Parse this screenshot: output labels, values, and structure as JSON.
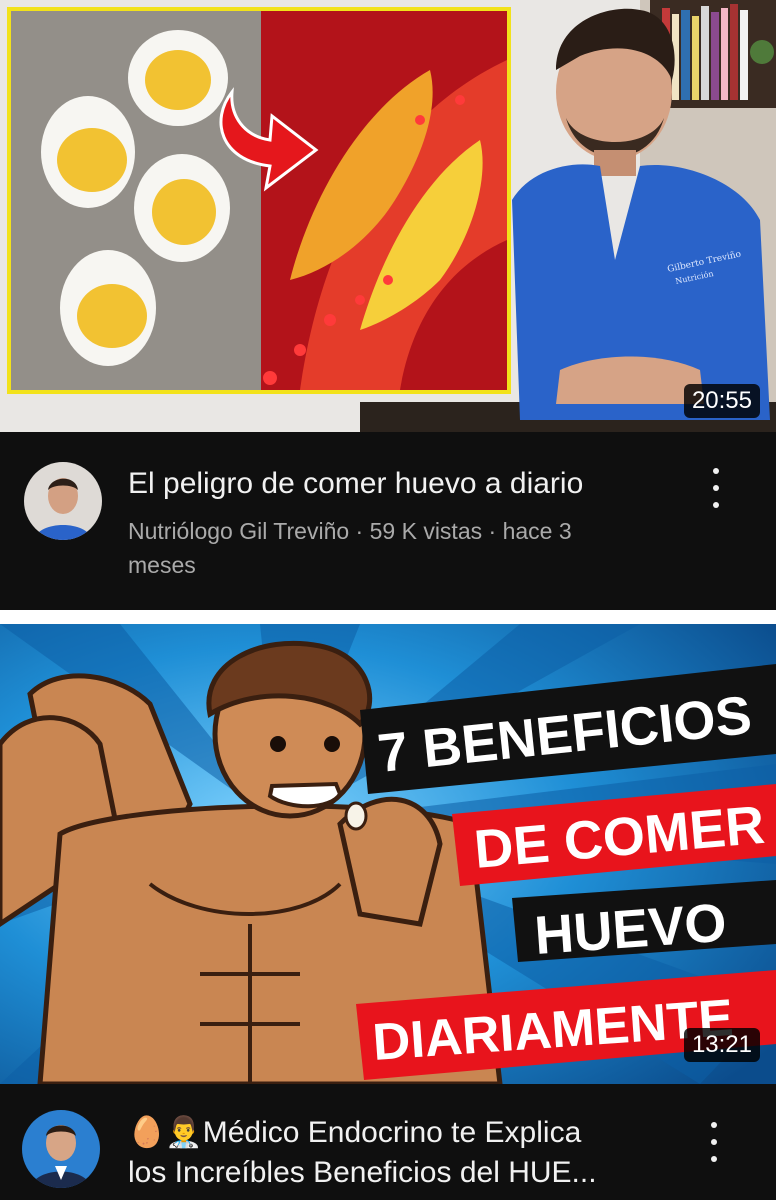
{
  "videos": [
    {
      "duration": "20:55",
      "title": "El peligro de comer huevo a diario",
      "channel": "Nutriólogo Gil Treviño",
      "views": "59 K vistas",
      "age": "hace 3",
      "age_wrap": "meses",
      "dot": "·",
      "shirt_text": "Gilberto Treviño",
      "shirt_sub": "Nutrición"
    },
    {
      "duration": "13:21",
      "thumb_lines": [
        "7 BENEFICIOS",
        "DE COMER",
        "HUEVO",
        "DIARIAMENTE"
      ],
      "title_emoji": "🥚👨‍⚕️",
      "title_line1": "Médico Endocrino te Explica",
      "title_line2": "los Increíbles Beneficios del HUE..."
    }
  ],
  "colors": {
    "background": "#0f0f0f",
    "title": "#f1f1f1",
    "subtitle": "#aaaaaa",
    "thumb_red_banner": "#e8141c",
    "thumb_black_banner": "#111111",
    "thumb_blue_bg": "#1f8fd6",
    "scrubs_blue": "#2a63c9",
    "egg_yellow": "#f2c232"
  },
  "icons": [
    "more-vert-icon"
  ]
}
